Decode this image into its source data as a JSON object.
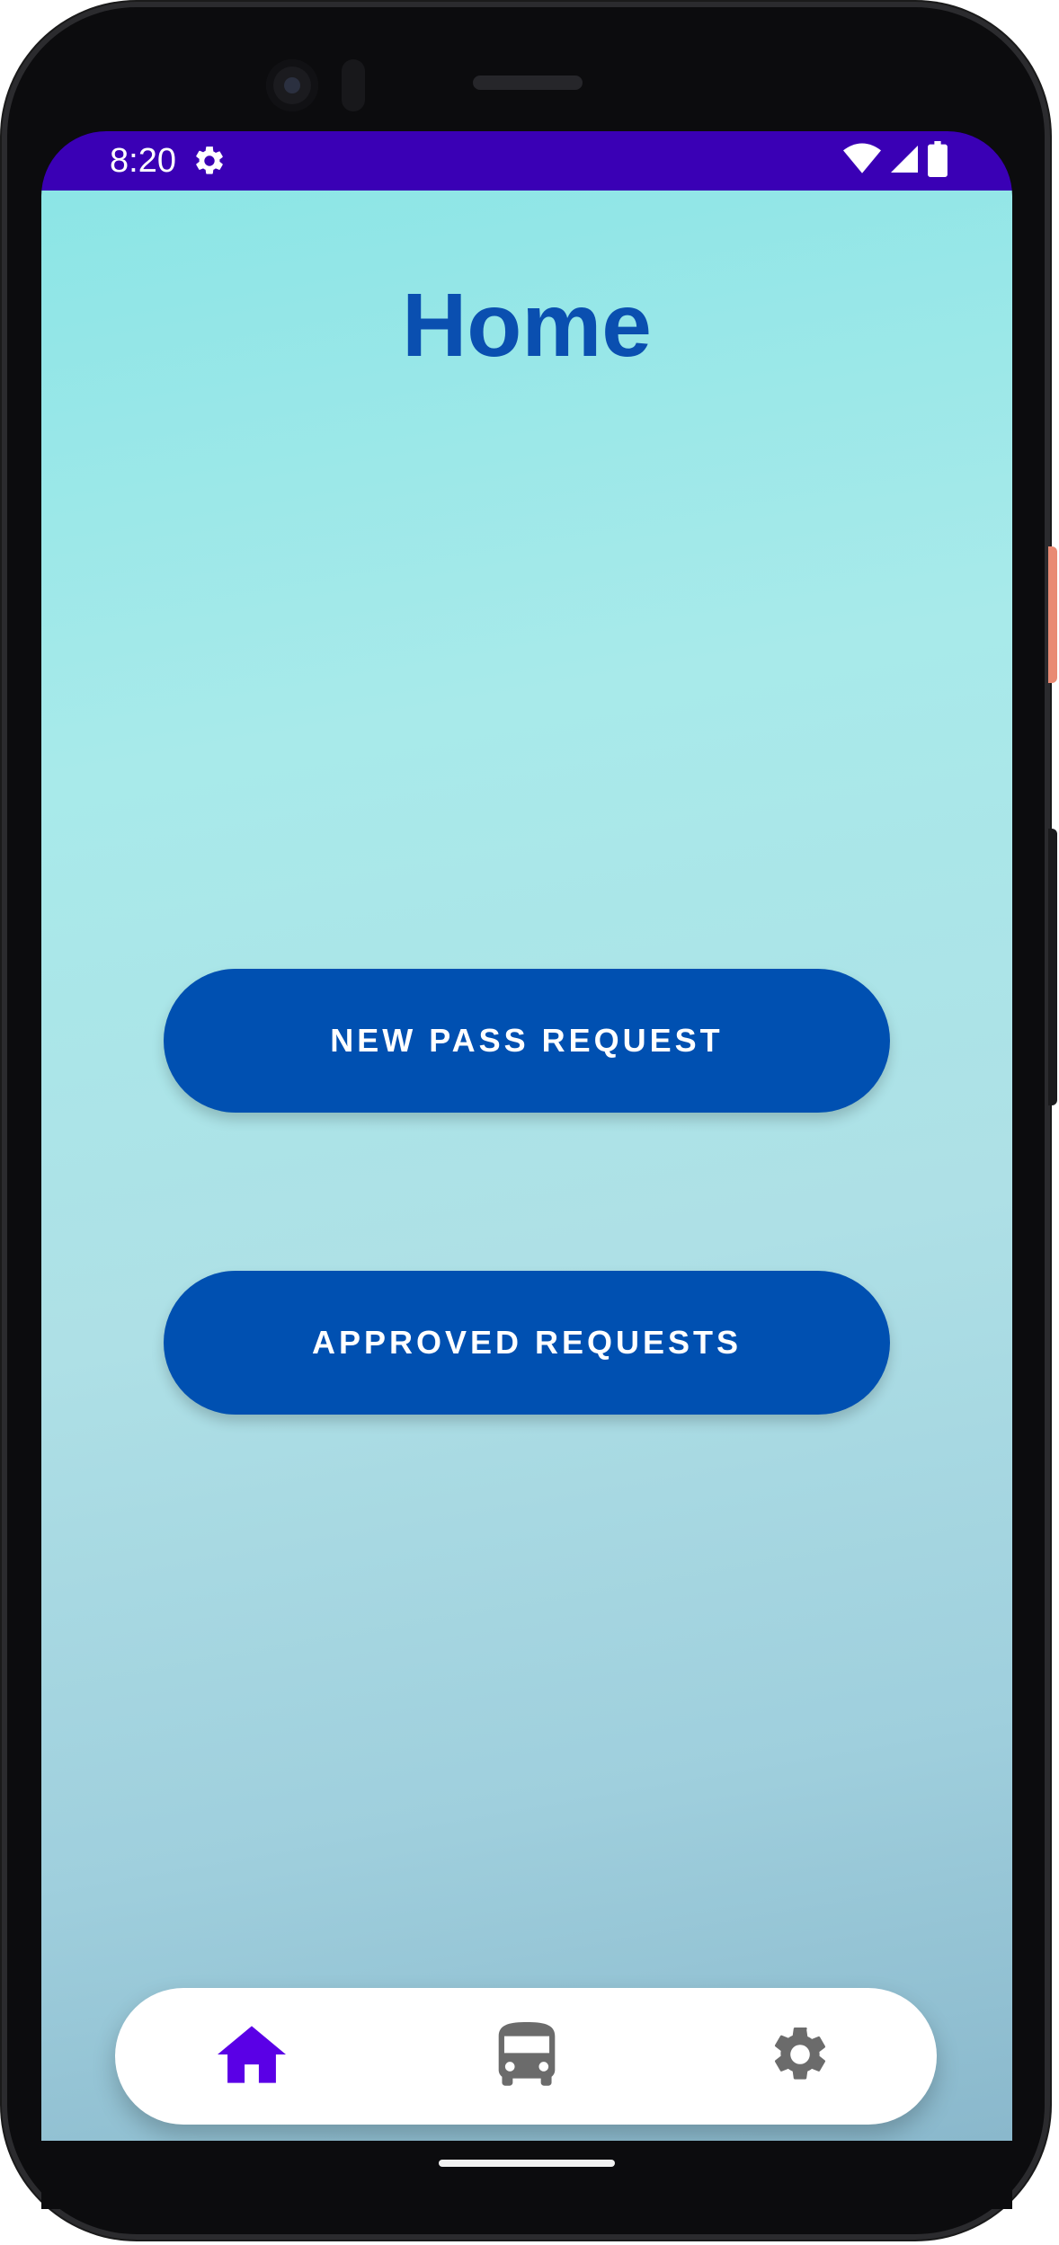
{
  "status_bar": {
    "time": "8:20",
    "left_icons": [
      "gear-icon"
    ],
    "right_icons": [
      "wifi-icon",
      "cell-signal-icon",
      "battery-icon"
    ],
    "color": "#3a00b5"
  },
  "page": {
    "title": "Home",
    "title_color": "#0a4fb0"
  },
  "buttons": {
    "new_pass_request": "NEW PASS REQUEST",
    "approved_requests": "APPROVED REQUESTS",
    "color": "#0050b1"
  },
  "bottom_nav": {
    "items": [
      {
        "icon": "home-icon",
        "active": true,
        "color": "#5a00e6"
      },
      {
        "icon": "bus-icon",
        "active": false,
        "color": "#6b6b6b"
      },
      {
        "icon": "settings-icon",
        "active": false,
        "color": "#6b6b6b"
      }
    ]
  }
}
